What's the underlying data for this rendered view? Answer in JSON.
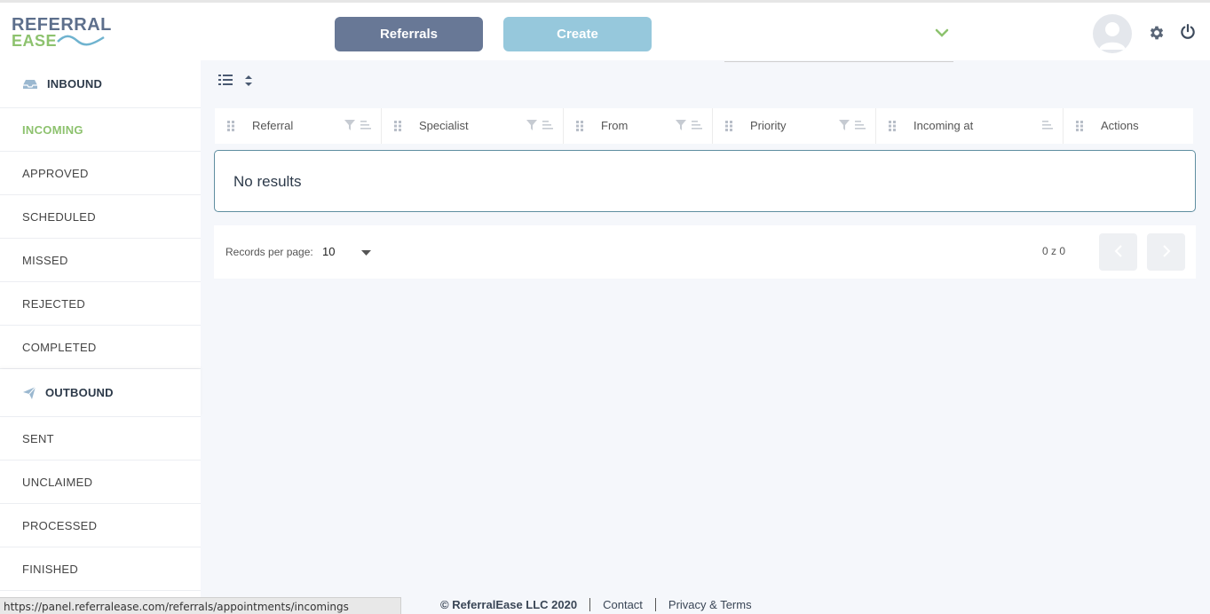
{
  "logo": {
    "line1": "REFERRAL",
    "line2": "EASE"
  },
  "header": {
    "referrals_label": "Referrals",
    "create_label": "Create",
    "location_value": ""
  },
  "sidebar": {
    "inbound": {
      "title": "INBOUND",
      "items": [
        "INCOMING",
        "APPROVED",
        "SCHEDULED",
        "MISSED",
        "REJECTED",
        "COMPLETED"
      ],
      "active": "INCOMING"
    },
    "outbound": {
      "title": "OUTBOUND",
      "items": [
        "SENT",
        "UNCLAIMED",
        "PROCESSED",
        "FINISHED"
      ]
    }
  },
  "table": {
    "columns": [
      "Referral",
      "Specialist",
      "From",
      "Priority",
      "Incoming at",
      "Actions"
    ],
    "empty_message": "No results"
  },
  "pager": {
    "records_label": "Records per page:",
    "records_value": "10",
    "count": "0 z 0"
  },
  "footer": {
    "copyright": "© ReferralEase LLC 2020",
    "contact": "Contact",
    "privacy": "Privacy & Terms"
  },
  "status_url": "https://panel.referralease.com/referrals/appointments/incomings",
  "colors": {
    "primary_button": "#687896",
    "secondary_button": "#96c8dc",
    "active_nav": "#8dc26e",
    "logo_blue": "#5d6f8c",
    "logo_green": "#8dc26e"
  }
}
